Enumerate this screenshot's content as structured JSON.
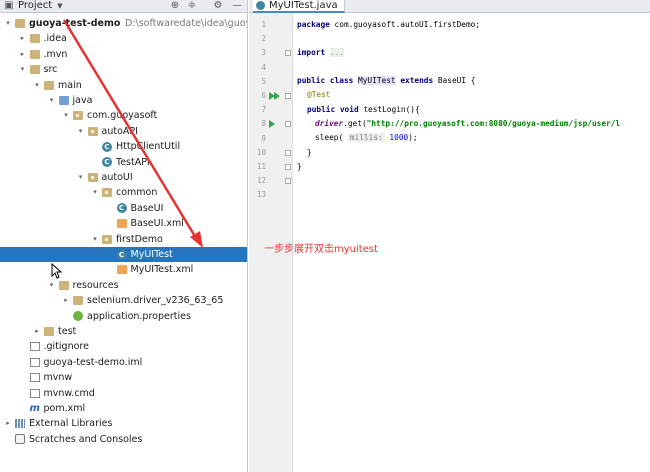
{
  "project_pane": {
    "title": "Project",
    "tree": [
      {
        "label": "guoya-test-demo",
        "path": "D:\\softwaredate\\idea\\guoya-te",
        "icon": "folder-icon",
        "depth": 0,
        "arrow": "▾",
        "bold": true
      },
      {
        "label": ".idea",
        "icon": "folder-icon",
        "depth": 1,
        "arrow": "▸"
      },
      {
        "label": ".mvn",
        "icon": "folder-icon",
        "depth": 1,
        "arrow": "▸"
      },
      {
        "label": "src",
        "icon": "folder-icon",
        "depth": 1,
        "arrow": "▾"
      },
      {
        "label": "main",
        "icon": "folder-icon",
        "depth": 2,
        "arrow": "▾"
      },
      {
        "label": "java",
        "icon": "source-folder-icon",
        "depth": 3,
        "arrow": "▾"
      },
      {
        "label": "com.guoyasoft",
        "icon": "package-icon",
        "depth": 4,
        "arrow": "▾"
      },
      {
        "label": "autoAPI",
        "icon": "package-icon",
        "depth": 5,
        "arrow": "▾"
      },
      {
        "label": "HttpClientUtil",
        "icon": "class-icon",
        "depth": 6,
        "arrow": ""
      },
      {
        "label": "TestAPI",
        "icon": "class-icon",
        "depth": 6,
        "arrow": ""
      },
      {
        "label": "autoUI",
        "icon": "package-icon",
        "depth": 5,
        "arrow": "▾"
      },
      {
        "label": "common",
        "icon": "package-icon",
        "depth": 6,
        "arrow": "▾"
      },
      {
        "label": "BaseUI",
        "icon": "class-icon",
        "depth": 7,
        "arrow": ""
      },
      {
        "label": "BaseUI.xml",
        "icon": "xml-file-icon",
        "depth": 7,
        "arrow": ""
      },
      {
        "label": "firstDemo",
        "icon": "package-icon",
        "depth": 6,
        "arrow": "▾"
      },
      {
        "label": "MyUITest",
        "icon": "class-icon",
        "depth": 7,
        "arrow": "",
        "selected": true
      },
      {
        "label": "MyUITest.xml",
        "icon": "xml-file-icon",
        "depth": 7,
        "arrow": ""
      },
      {
        "label": "resources",
        "icon": "resources-folder-icon",
        "depth": 3,
        "arrow": "▾"
      },
      {
        "label": "selenium.driver_v236_63_65",
        "icon": "folder-icon",
        "depth": 4,
        "arrow": "▸"
      },
      {
        "label": "application.properties",
        "icon": "spring-properties-icon",
        "depth": 4,
        "arrow": ""
      },
      {
        "label": "test",
        "icon": "folder-icon",
        "depth": 2,
        "arrow": "▸"
      },
      {
        "label": ".gitignore",
        "icon": "file-icon",
        "depth": 1,
        "arrow": ""
      },
      {
        "label": "guoya-test-demo.iml",
        "icon": "file-icon",
        "depth": 1,
        "arrow": ""
      },
      {
        "label": "mvnw",
        "icon": "file-icon",
        "depth": 1,
        "arrow": ""
      },
      {
        "label": "mvnw.cmd",
        "icon": "file-icon",
        "depth": 1,
        "arrow": ""
      },
      {
        "label": "pom.xml",
        "icon": "maven-icon",
        "depth": 1,
        "arrow": ""
      },
      {
        "label": "External Libraries",
        "icon": "library-icon",
        "depth": 0,
        "arrow": "▸"
      },
      {
        "label": "Scratches and Consoles",
        "icon": "scratch-icon",
        "depth": 0,
        "arrow": ""
      }
    ]
  },
  "editor": {
    "tab_label": "MyUITest.java",
    "line_numbers": [
      "1",
      "2",
      "3",
      "4",
      "5",
      "6",
      "7",
      "8",
      "9",
      "10",
      "11",
      "12",
      "13"
    ],
    "code": {
      "l1_kw": "package",
      "l1_rest": " com.guoyasoft.autoUI.firstDemo;",
      "l3_kw": "import",
      "l3_fold": "...",
      "l6_kw1": "public class",
      "l6_cls": "MyUITest",
      "l6_kw2": "extends",
      "l6_rest": " BaseUI {",
      "l7_ann": "@Test",
      "l8_kw": "public void",
      "l8_rest": " testLogin(){",
      "l9_fld": "driver",
      "l9_mid": ".get(",
      "l9_str": "\"http://pro.guoyasoft.com:8080/guoya-medium/jsp/user/l",
      "l10_call": "sleep(",
      "l10_hint": "millis:",
      "l10_num": " 1000",
      "l10_end": ");",
      "l11": "}",
      "l12": "}"
    }
  },
  "annotation": {
    "text": "一步步展开双击myuitest",
    "color": "#e53333"
  },
  "colors": {
    "selection": "#2675bf",
    "header": "#e9edf2",
    "keyword": "#000080",
    "string": "#008000",
    "annotation": "#808000",
    "arrow": "#e53333"
  }
}
